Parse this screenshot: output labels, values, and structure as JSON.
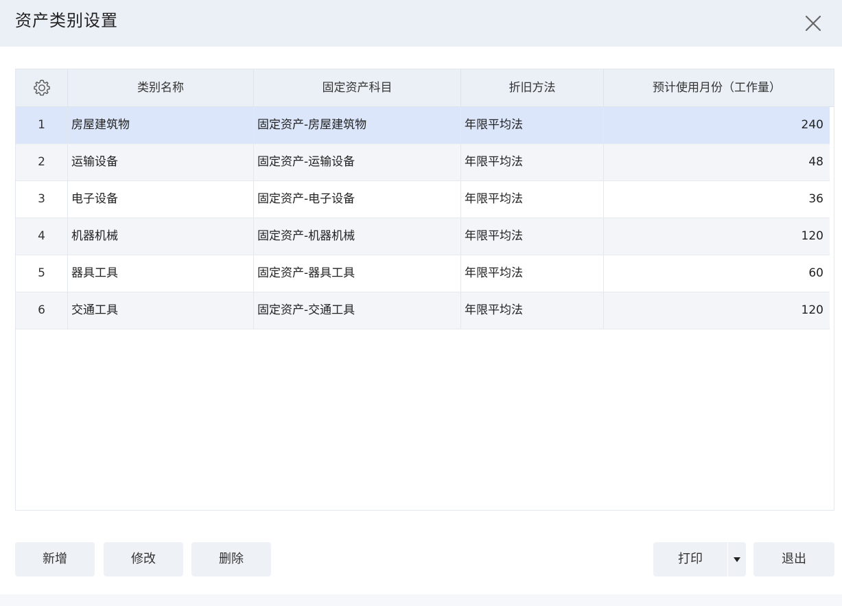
{
  "window": {
    "title": "资产类别设置",
    "close_icon": "close-icon"
  },
  "table": {
    "settings_icon": "gear-icon",
    "columns": [
      "类别名称",
      "固定资产科目",
      "折旧方法",
      "预计使用月份（工作量）"
    ],
    "rows": [
      {
        "index": "1",
        "name": "房屋建筑物",
        "account": "固定资产-房屋建筑物",
        "method": "年限平均法",
        "months": "240"
      },
      {
        "index": "2",
        "name": "运输设备",
        "account": "固定资产-运输设备",
        "method": "年限平均法",
        "months": "48"
      },
      {
        "index": "3",
        "name": "电子设备",
        "account": "固定资产-电子设备",
        "method": "年限平均法",
        "months": "36"
      },
      {
        "index": "4",
        "name": "机器机械",
        "account": "固定资产-机器机械",
        "method": "年限平均法",
        "months": "120"
      },
      {
        "index": "5",
        "name": "器具工具",
        "account": "固定资产-器具工具",
        "method": "年限平均法",
        "months": "60"
      },
      {
        "index": "6",
        "name": "交通工具",
        "account": "固定资产-交通工具",
        "method": "年限平均法",
        "months": "120"
      }
    ],
    "selected_row": 0
  },
  "buttons": {
    "add": "新增",
    "edit": "修改",
    "delete": "删除",
    "print": "打印",
    "print_menu_icon": "caret-down-icon",
    "exit": "退出"
  },
  "colors": {
    "titlebar_bg": "#ebeff6",
    "header_bg": "#ebf0f7",
    "selected_row_bg": "#dbe6fa",
    "button_bg": "#eef1f5"
  }
}
